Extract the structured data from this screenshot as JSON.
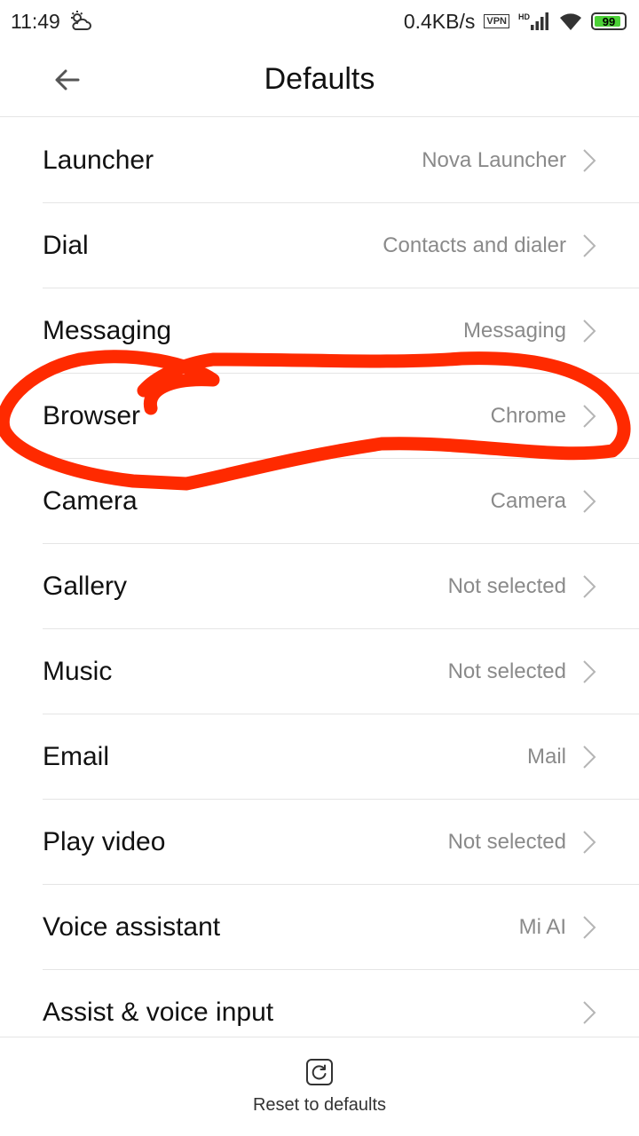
{
  "status_bar": {
    "time": "11:49",
    "net_speed": "0.4KB/s",
    "vpn": "VPN",
    "signal_tag": "HD",
    "battery": "99",
    "weather_icon": "cloud-sun-icon",
    "wifi_icon": "wifi-icon",
    "signal_icon": "signal-bars-icon"
  },
  "header": {
    "title": "Defaults",
    "back_icon": "back-arrow-icon"
  },
  "items": [
    {
      "label": "Launcher",
      "value": "Nova Launcher"
    },
    {
      "label": "Dial",
      "value": "Contacts and dialer"
    },
    {
      "label": "Messaging",
      "value": "Messaging"
    },
    {
      "label": "Browser",
      "value": "Chrome"
    },
    {
      "label": "Camera",
      "value": "Camera"
    },
    {
      "label": "Gallery",
      "value": "Not selected"
    },
    {
      "label": "Music",
      "value": "Not selected"
    },
    {
      "label": "Email",
      "value": "Mail"
    },
    {
      "label": "Play video",
      "value": "Not selected"
    },
    {
      "label": "Voice assistant",
      "value": "Mi AI"
    },
    {
      "label": "Assist & voice input",
      "value": ""
    }
  ],
  "footer": {
    "reset_label": "Reset to defaults",
    "reset_icon": "reset-icon"
  },
  "colors": {
    "annotation": "#ff2a00",
    "battery": "#4cd137",
    "secondary_text": "#8a8a8a",
    "divider": "#e5e5e5"
  }
}
